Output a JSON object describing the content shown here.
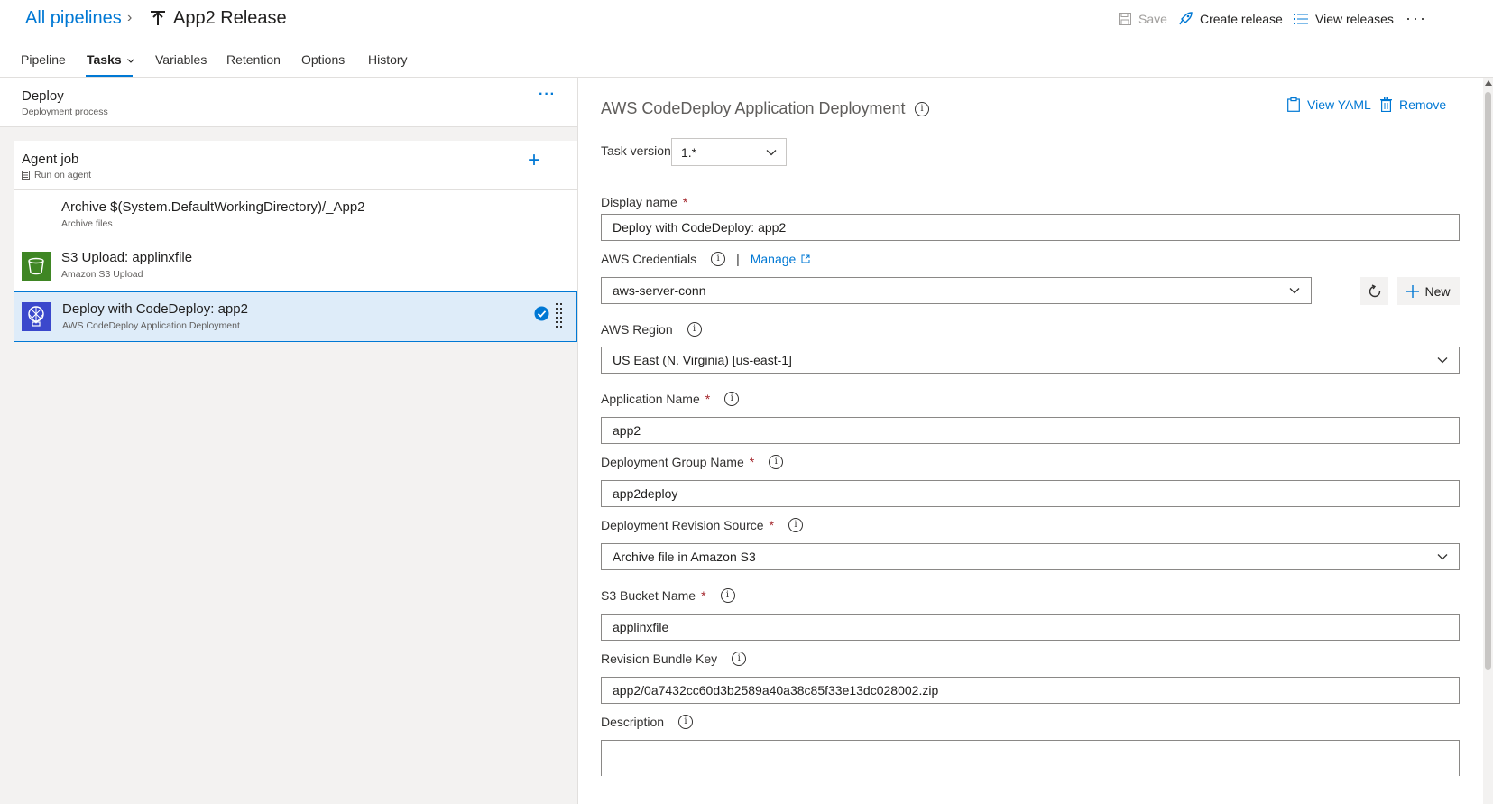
{
  "breadcrumb": {
    "root": "All pipelines",
    "separator": "›",
    "title": "App2 Release"
  },
  "header_actions": {
    "save": "Save",
    "create_release": "Create release",
    "view_releases": "View releases",
    "more": "···"
  },
  "tabs": [
    {
      "label": "Pipeline"
    },
    {
      "label": "Tasks",
      "active": true
    },
    {
      "label": "Variables"
    },
    {
      "label": "Retention"
    },
    {
      "label": "Options"
    },
    {
      "label": "History"
    }
  ],
  "stage": {
    "title": "Deploy",
    "subtitle": "Deployment process",
    "more": "···"
  },
  "agent_job": {
    "title": "Agent job",
    "subtitle": "Run on agent",
    "add": "+"
  },
  "tasks": [
    {
      "title": "Archive $(System.DefaultWorkingDirectory)/_App2",
      "subtitle": "Archive files",
      "icon": "archive-icon"
    },
    {
      "title": "S3 Upload: applinxfile",
      "subtitle": "Amazon S3 Upload",
      "icon": "s3-bucket-icon"
    },
    {
      "title": "Deploy with CodeDeploy: app2",
      "subtitle": "AWS CodeDeploy Application Deployment",
      "icon": "codedeploy-icon",
      "selected": true
    }
  ],
  "task_panel": {
    "heading": "AWS CodeDeploy Application Deployment",
    "view_yaml": "View YAML",
    "remove": "Remove",
    "task_version_label": "Task version",
    "task_version_value": "1.*",
    "display_name_label": "Display name",
    "display_name_value": "Deploy with CodeDeploy: app2",
    "aws_credentials_label": "AWS Credentials",
    "manage_link": "Manage",
    "aws_credentials_value": "aws-server-conn",
    "new_button": "New",
    "aws_region_label": "AWS Region",
    "aws_region_value": "US East (N. Virginia) [us-east-1]",
    "application_name_label": "Application Name",
    "application_name_value": "app2",
    "deployment_group_label": "Deployment Group Name",
    "deployment_group_value": "app2deploy",
    "revision_source_label": "Deployment Revision Source",
    "revision_source_value": "Archive file in Amazon S3",
    "s3_bucket_label": "S3 Bucket Name",
    "s3_bucket_value": "applinxfile",
    "bundle_key_label": "Revision Bundle Key",
    "bundle_key_value": "app2/0a7432cc60d3b2589a40a38c85f33e13dc028002.zip",
    "description_label": "Description",
    "description_value": "",
    "required_marker": "*",
    "info_glyph": "i"
  },
  "colors": {
    "accent": "#0078d4",
    "selected_bg": "#deecf9",
    "panel_bg": "#f3f2f1",
    "s3_green": "#3f8624",
    "codedeploy_blue": "#3b48cc",
    "required": "#a4262c"
  }
}
